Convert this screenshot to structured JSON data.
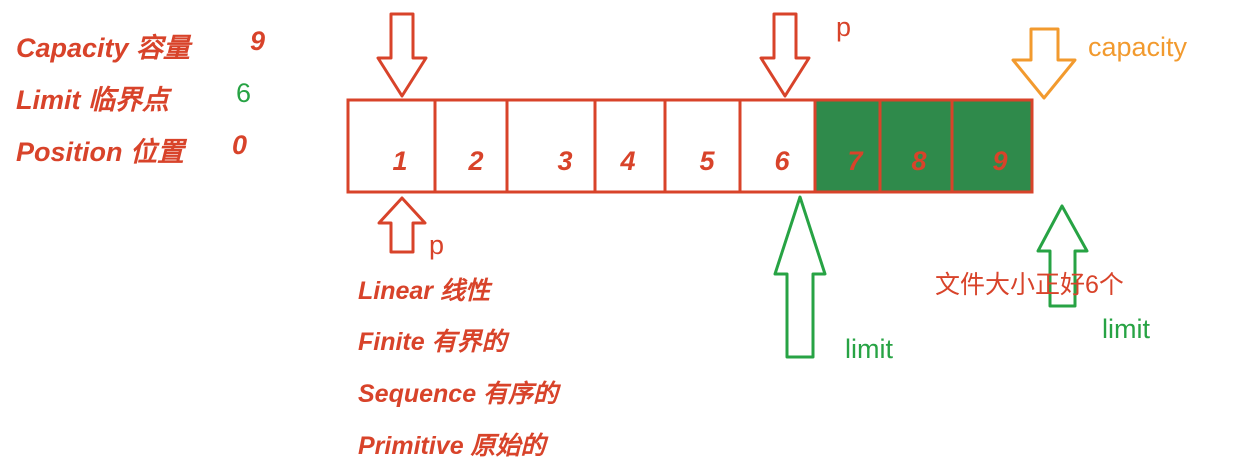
{
  "properties": [
    {
      "label": "Capacity 容量",
      "value": "9",
      "value_color": "#d8432a"
    },
    {
      "label": "Limit 临界点",
      "value": "6",
      "value_color": "#27a344"
    },
    {
      "label": "Position 位置",
      "value": "0",
      "value_color": "#d8432a"
    }
  ],
  "cells": [
    {
      "text": "1",
      "filled": false
    },
    {
      "text": "2",
      "filled": false
    },
    {
      "text": "3",
      "filled": false
    },
    {
      "text": "4",
      "filled": false
    },
    {
      "text": "5",
      "filled": false
    },
    {
      "text": "6",
      "filled": false
    },
    {
      "text": "7",
      "filled": true
    },
    {
      "text": "8",
      "filled": true
    },
    {
      "text": "9",
      "filled": true
    }
  ],
  "labels": {
    "p_top": "p",
    "p_bottom": "p",
    "capacity": "capacity",
    "limit_main": "limit",
    "limit_alt": "limit",
    "file_note": "文件大小正好6个"
  },
  "keywords": [
    "Linear 线性",
    "Finite 有界的",
    "Sequence 有序的",
    "Primitive 原始的"
  ],
  "colors": {
    "red": "#d8432a",
    "green": "#27a344",
    "fill_green": "#2f8a4b",
    "orange": "#f29a2e"
  }
}
